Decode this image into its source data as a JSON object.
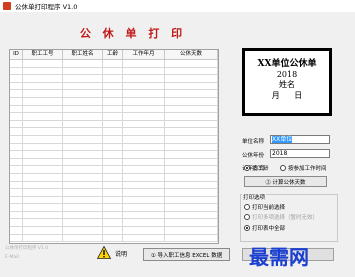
{
  "window": {
    "title": "公休单打印程序 V1.0"
  },
  "heading": "公 休 单 打 印",
  "grid": {
    "columns": [
      "ID",
      "职工工号",
      "职工姓名",
      "工龄",
      "工作年月",
      "公休天数"
    ],
    "row_count": 24
  },
  "bottom_left": {
    "line1": "公休单打印程序 V1.0",
    "line2": "E-Mail: "
  },
  "note_label": "说明",
  "import_button": "① 导入职工信息 EXCEL 数据",
  "preview": {
    "title": "XX单位公休单",
    "year": "2018",
    "name": "姓名",
    "date": "月 日"
  },
  "unit": {
    "label": "单位名称",
    "value": "XX单位"
  },
  "year": {
    "label": "公休年份",
    "value": "2018"
  },
  "calc_method": {
    "label": "计年方式",
    "options": [
      "按工龄",
      "按参加工作时间"
    ],
    "selected": 0
  },
  "calc_button": "② 计算公休天数",
  "print_options": {
    "label": "打印选项",
    "options": [
      "打印当前选择",
      "打印多项选择（暂时无效）",
      "打印表中全部"
    ],
    "selected": 2,
    "disabled": [
      1
    ]
  },
  "watermark": "最需网"
}
